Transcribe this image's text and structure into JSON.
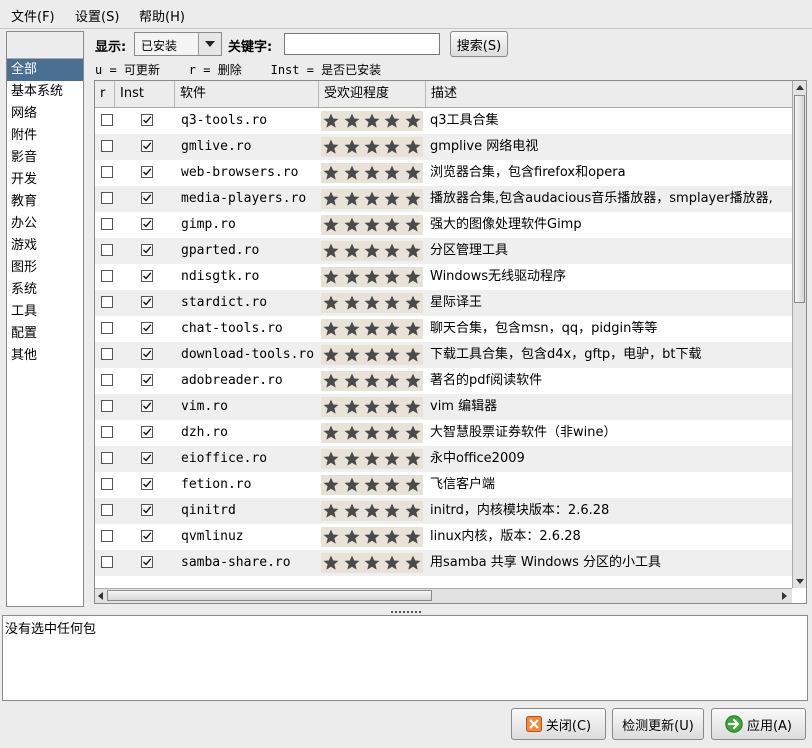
{
  "menubar": {
    "file": "文件(F)",
    "settings": "设置(S)",
    "help": "帮助(H)"
  },
  "categories": [
    {
      "label": "全部",
      "selected": true
    },
    {
      "label": "基本系统"
    },
    {
      "label": "网络"
    },
    {
      "label": "附件"
    },
    {
      "label": "影音"
    },
    {
      "label": "开发"
    },
    {
      "label": "教育"
    },
    {
      "label": "办公"
    },
    {
      "label": "游戏"
    },
    {
      "label": "图形"
    },
    {
      "label": "系统"
    },
    {
      "label": "工具"
    },
    {
      "label": "配置"
    },
    {
      "label": "其他"
    }
  ],
  "toolbar": {
    "show_label": "显示:",
    "show_value": "已安装",
    "keyword_label": "关键字:",
    "keyword_value": "",
    "search_button": "搜索(S)"
  },
  "legend": "u = 可更新    r = 删除    Inst = 是否已安装",
  "table": {
    "columns": [
      "r",
      "Inst",
      "软件",
      "受欢迎程度",
      "描述"
    ],
    "rows": [
      {
        "name": "q3-tools.ro",
        "desc": "q3工具合集",
        "r": false,
        "inst": true,
        "stars": 5
      },
      {
        "name": "gmlive.ro",
        "desc": "gmplive 网络电视",
        "r": false,
        "inst": true,
        "stars": 5
      },
      {
        "name": "web-browsers.ro",
        "desc": "浏览器合集，包含firefox和opera",
        "r": false,
        "inst": true,
        "stars": 5
      },
      {
        "name": "media-players.ro",
        "desc": "播放器合集,包含audacious音乐播放器，smplayer播放器,",
        "r": false,
        "inst": true,
        "stars": 5
      },
      {
        "name": "gimp.ro",
        "desc": "强大的图像处理软件Gimp",
        "r": false,
        "inst": true,
        "stars": 5
      },
      {
        "name": "gparted.ro",
        "desc": "分区管理工具",
        "r": false,
        "inst": true,
        "stars": 5
      },
      {
        "name": "ndisgtk.ro",
        "desc": "Windows无线驱动程序",
        "r": false,
        "inst": true,
        "stars": 5
      },
      {
        "name": "stardict.ro",
        "desc": "星际译王",
        "r": false,
        "inst": true,
        "stars": 5
      },
      {
        "name": "chat-tools.ro",
        "desc": "聊天合集，包含msn，qq，pidgin等等",
        "r": false,
        "inst": true,
        "stars": 5
      },
      {
        "name": "download-tools.ro",
        "desc": "下载工具合集，包含d4x，gftp，电驴，bt下载",
        "r": false,
        "inst": true,
        "stars": 5
      },
      {
        "name": "adobreader.ro",
        "desc": "著名的pdf阅读软件",
        "r": false,
        "inst": true,
        "stars": 5
      },
      {
        "name": "vim.ro",
        "desc": "vim 编辑器",
        "r": false,
        "inst": true,
        "stars": 5
      },
      {
        "name": "dzh.ro",
        "desc": "大智慧股票证券软件（非wine）",
        "r": false,
        "inst": true,
        "stars": 5
      },
      {
        "name": "eioffice.ro",
        "desc": "永中office2009",
        "r": false,
        "inst": true,
        "stars": 5
      },
      {
        "name": "fetion.ro",
        "desc": "飞信客户端",
        "r": false,
        "inst": true,
        "stars": 5
      },
      {
        "name": "qinitrd",
        "desc": "initrd，内核模块版本：2.6.28",
        "r": false,
        "inst": true,
        "stars": 5
      },
      {
        "name": "qvmlinuz",
        "desc": "linux内核，版本：2.6.28",
        "r": false,
        "inst": true,
        "stars": 5
      },
      {
        "name": "samba-share.ro",
        "desc": "用samba 共享 Windows 分区的小工具",
        "r": false,
        "inst": true,
        "stars": 5
      }
    ]
  },
  "info": {
    "text": "没有选中任何包"
  },
  "buttons": {
    "close": "关闭(C)",
    "check_update": "检测更新(U)",
    "apply": "应用(A)"
  },
  "colors": {
    "selection": "#4a6f93",
    "star": "#4a4a4a",
    "star_bg": "#e9e2d8",
    "row_alt": "#efefef"
  },
  "icons": {
    "close_icon": "close-x-icon",
    "apply_icon": "green-arrow-icon"
  }
}
